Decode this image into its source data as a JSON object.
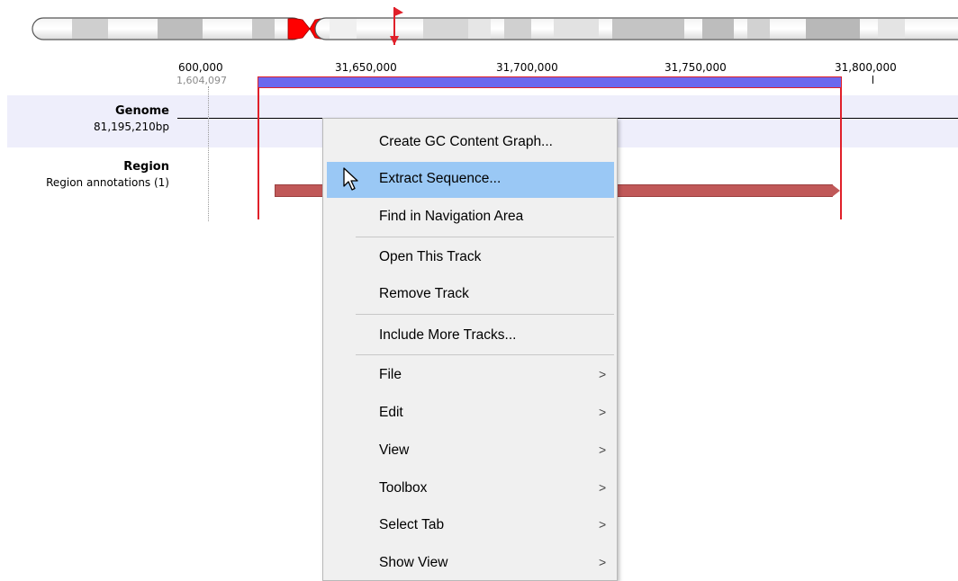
{
  "colors": {
    "selection_fill": "#6b68ee",
    "selection_border": "#e0202a",
    "track_band": "#eeeefb",
    "annotation": "#c05858",
    "centromere": "#ff0000",
    "menu_highlight": "#9ac8f5",
    "menu_background": "#f0f0f0"
  },
  "ruler": {
    "labels": [
      "600,000",
      "31,650,000",
      "31,700,000",
      "31,750,000",
      "31,800,000"
    ],
    "sub_label": "1,604,097"
  },
  "tracks": {
    "genome": {
      "title": "Genome",
      "subtitle": "81,195,210bp"
    },
    "region": {
      "title": "Region",
      "subtitle": "Region annotations (1)"
    }
  },
  "context_menu": {
    "items": [
      {
        "label": "Create GC Content Graph...",
        "submenu": false
      },
      {
        "label": "Extract Sequence...",
        "submenu": false,
        "highlighted": true
      },
      {
        "label": "Find in Navigation Area",
        "submenu": false
      },
      {
        "label": "Open This Track",
        "submenu": false
      },
      {
        "label": "Remove Track",
        "submenu": false
      },
      {
        "label": "Include More Tracks...",
        "submenu": false
      },
      {
        "label": "File",
        "submenu": true
      },
      {
        "label": "Edit",
        "submenu": true
      },
      {
        "label": "View",
        "submenu": true
      },
      {
        "label": "Toolbox",
        "submenu": true
      },
      {
        "label": "Select Tab",
        "submenu": true
      },
      {
        "label": "Show View",
        "submenu": true
      }
    ],
    "submenu_glyph": ">"
  },
  "icons": {
    "cursor": "arrow-cursor-icon",
    "position_marker": "red-position-marker-icon"
  }
}
